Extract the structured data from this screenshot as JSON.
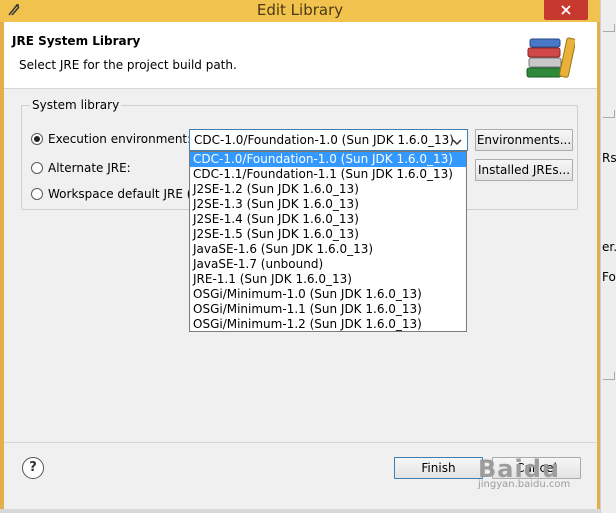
{
  "window": {
    "title": "Edit Library"
  },
  "header": {
    "title": "JRE System Library",
    "description": "Select JRE for the project build path."
  },
  "group": {
    "legend": "System library",
    "radios": [
      {
        "label": "Execution environment:",
        "checked": true
      },
      {
        "label": "Alternate JRE:",
        "checked": false
      },
      {
        "label": "Workspace default JRE (s",
        "checked": false
      }
    ],
    "combo_value": "CDC-1.0/Foundation-1.0 (Sun JDK 1.6.0_13)",
    "environments_button": "Environments...",
    "installed_jres_button": "Installed JREs..."
  },
  "dropdown": {
    "selected_index": 0,
    "options": [
      "CDC-1.0/Foundation-1.0 (Sun JDK 1.6.0_13)",
      "CDC-1.1/Foundation-1.1 (Sun JDK 1.6.0_13)",
      "J2SE-1.2 (Sun JDK 1.6.0_13)",
      "J2SE-1.3 (Sun JDK 1.6.0_13)",
      "J2SE-1.4 (Sun JDK 1.6.0_13)",
      "J2SE-1.5 (Sun JDK 1.6.0_13)",
      "JavaSE-1.6 (Sun JDK 1.6.0_13)",
      "JavaSE-1.7 (unbound)",
      "JRE-1.1 (Sun JDK 1.6.0_13)",
      "OSGi/Minimum-1.0 (Sun JDK 1.6.0_13)",
      "OSGi/Minimum-1.1 (Sun JDK 1.6.0_13)",
      "OSGi/Minimum-1.2 (Sun JDK 1.6.0_13)"
    ]
  },
  "footer": {
    "help_symbol": "?",
    "finish_button": "Finish",
    "cancel_button": "Cancel"
  },
  "background_fragments": [
    "Rs",
    "er.",
    "Fo"
  ],
  "watermark": {
    "logo": "Baidu",
    "sub": "jingyan.baidu.com"
  },
  "colors": {
    "titlebar": "#f2c24f",
    "close_button": "#c7382e",
    "selection": "#3399ff",
    "focus_border": "#3c7fb1"
  },
  "icons": [
    "eclipse-app-icon",
    "close-icon",
    "books-library-icon",
    "dropdown-arrow-icon",
    "help-icon"
  ]
}
